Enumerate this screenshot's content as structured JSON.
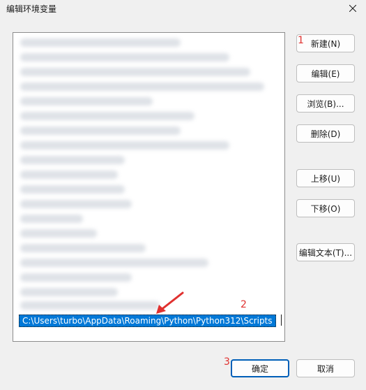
{
  "window": {
    "title": "编辑环境变量"
  },
  "list": {
    "selected_entry": "C:\\Users\\turbo\\AppData\\Roaming\\Python\\Python312\\Scripts"
  },
  "buttons": {
    "new": "新建(N)",
    "edit": "编辑(E)",
    "browse": "浏览(B)...",
    "delete": "删除(D)",
    "move_up": "上移(U)",
    "move_down": "下移(O)",
    "edit_text": "编辑文本(T)...",
    "ok": "确定",
    "cancel": "取消"
  },
  "annotations": {
    "label1": "1",
    "label2": "2",
    "label3": "3"
  },
  "colors": {
    "selection": "#0078d7",
    "primary_border": "#005fb8",
    "annotation": "#e0312f"
  },
  "icons": {
    "close": "close-icon",
    "arrow": "arrow-icon"
  }
}
